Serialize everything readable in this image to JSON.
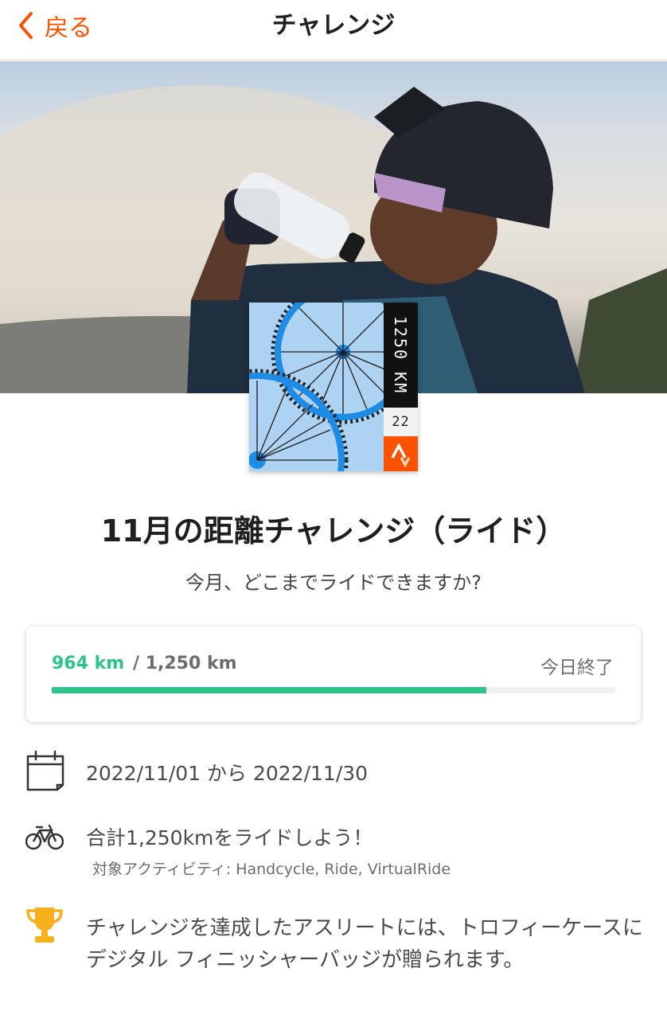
{
  "nav": {
    "back_label": "戻る",
    "title": "チャレンジ"
  },
  "badge": {
    "distance_label": "1250 KM",
    "number": "22"
  },
  "challenge": {
    "title": "11月の距離チャレンジ（ライド）",
    "subtitle": "今月、どこまでライドできますか?"
  },
  "progress": {
    "current": "964 km",
    "goal": "/ 1,250 km",
    "status": "今日終了",
    "fraction": 0.7712
  },
  "details": {
    "date_range": "2022/11/01 から 2022/11/30",
    "ride_goal": "合計1,250kmをライドしよう！",
    "activities": "対象アクティビティ: Handcycle, Ride, VirtualRide",
    "reward": "チャレンジを達成したアスリートには、トロフィーケースにデジタル フィニッシャーバッジが贈られます。"
  },
  "icons": {
    "back": "chevron-left-icon",
    "calendar": "calendar-icon",
    "bike": "bicycle-icon",
    "trophy": "trophy-icon",
    "brand": "strava-logo-icon"
  },
  "colors": {
    "accent": "#fc5200",
    "progress": "#2bc58a",
    "trophy": "#f5b01b",
    "badge_bg": "#aed3f2",
    "badge_wheel": "#1e8be4"
  }
}
